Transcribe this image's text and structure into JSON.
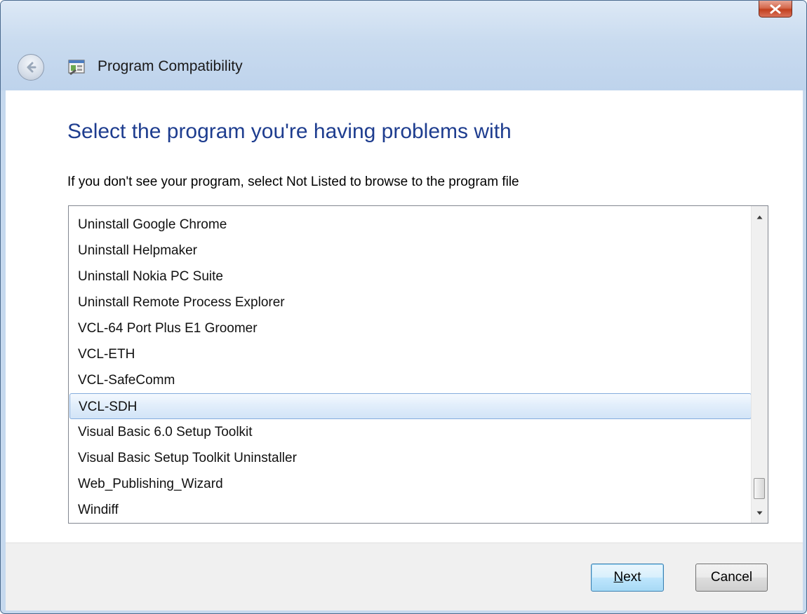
{
  "window": {
    "title": "Program Compatibility"
  },
  "content": {
    "heading": "Select the program you're having problems with",
    "instruction": "If you don't see your program, select Not Listed to browse to the program file"
  },
  "program_list": {
    "items": [
      "Uninstall Google Chrome",
      "Uninstall Helpmaker",
      "Uninstall Nokia PC Suite",
      "Uninstall Remote Process Explorer",
      "VCL-64 Port Plus E1 Groomer",
      "VCL-ETH",
      "VCL-SafeComm",
      "VCL-SDH",
      "Visual Basic 6.0 Setup Toolkit",
      "Visual Basic Setup Toolkit Uninstaller",
      "Web_Publishing_Wizard",
      "Windiff"
    ],
    "selected": "VCL-SDH"
  },
  "buttons": {
    "next_mnemonic": "N",
    "next_rest": "ext",
    "cancel": "Cancel"
  },
  "icons": {
    "close": "close-icon",
    "back": "back-arrow-icon",
    "app": "program-compatibility-icon",
    "scroll_up": "scroll-up-icon",
    "scroll_down": "scroll-down-icon"
  },
  "colors": {
    "heading": "#1e3d8f",
    "selection_border": "#84acdd",
    "close_button": "#c2401f"
  }
}
